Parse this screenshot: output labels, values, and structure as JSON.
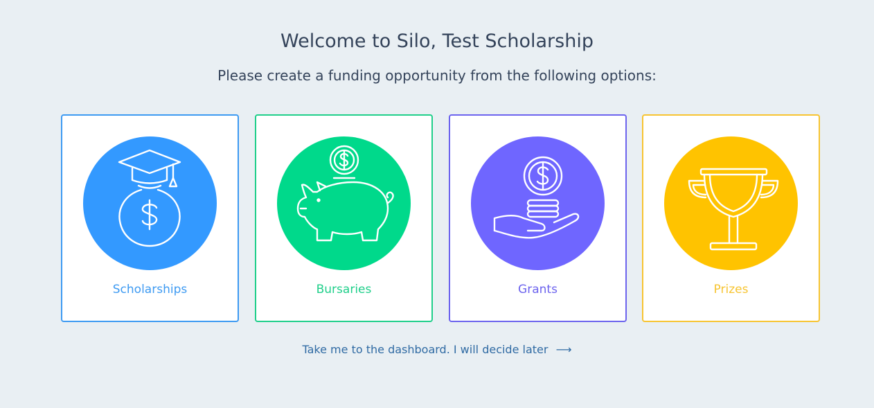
{
  "header": {
    "title": "Welcome to Silo, Test Scholarship",
    "subtitle": "Please create a funding opportunity from the following options:"
  },
  "cards": [
    {
      "label": "Scholarships",
      "color": "#3d9af2",
      "circle_color": "#3399ff",
      "icon": "graduation-money-bag-icon"
    },
    {
      "label": "Bursaries",
      "color": "#1fcf8a",
      "circle_color": "#00d98b",
      "icon": "piggy-bank-icon"
    },
    {
      "label": "Grants",
      "color": "#6c63ee",
      "circle_color": "#6f66ff",
      "icon": "hand-coins-icon"
    },
    {
      "label": "Prizes",
      "color": "#f7c430",
      "circle_color": "#ffc300",
      "icon": "trophy-icon"
    }
  ],
  "footer": {
    "link_text": "Take me to the dashboard. I will decide later",
    "arrow": "⟶"
  }
}
